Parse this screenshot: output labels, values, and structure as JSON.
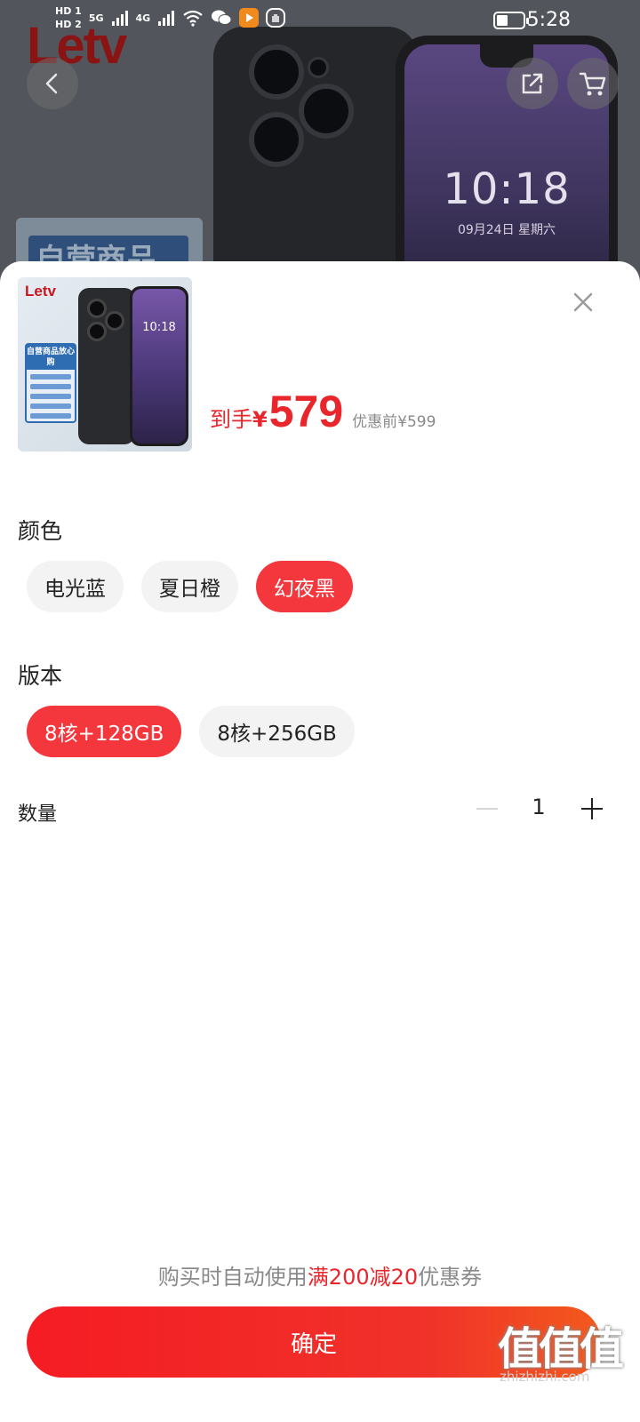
{
  "status_bar": {
    "time": "5:28",
    "net1": "HD 1",
    "net2": "HD 2",
    "sig1": "5G",
    "sig2": "4G"
  },
  "background": {
    "brand_logo": "Letv",
    "badge_text": "自营商品",
    "phone_time": "10:18",
    "phone_date": "09月24日 星期六"
  },
  "product": {
    "thumb_brand": "Letv",
    "thumb_badge_title": "自营商品放心购",
    "thumb_time": "10:18",
    "price_label": "到手",
    "currency": "¥",
    "price": "579",
    "original_price": "优惠前¥599"
  },
  "color_section": {
    "title": "颜色",
    "options": [
      "电光蓝",
      "夏日橙",
      "幻夜黑"
    ],
    "selected": "幻夜黑"
  },
  "version_section": {
    "title": "版本",
    "options": [
      "8核+128GB",
      "8核+256GB"
    ],
    "selected": "8核+128GB"
  },
  "quantity": {
    "label": "数量",
    "value": "1"
  },
  "coupon": {
    "prefix": "购买时自动使用",
    "highlight": "满200减20",
    "suffix": "优惠券"
  },
  "confirm_label": "确定",
  "watermark": {
    "text": "值值值",
    "sub": "zhizhizhi.com"
  },
  "colors": {
    "accent_red": "#f4373d",
    "price_red": "#e8262c"
  }
}
